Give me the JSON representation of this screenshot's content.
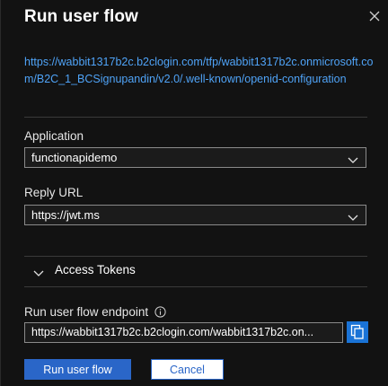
{
  "panel": {
    "title": "Run user flow",
    "metadata_url": "https://wabbit1317b2c.b2clogin.com/tfp/wabbit1317b2c.onmicrosoft.com/B2C_1_BCSignupandin/v2.0/.well-known/openid-configuration"
  },
  "application": {
    "label": "Application",
    "selected": "functionapidemo"
  },
  "reply_url": {
    "label": "Reply URL",
    "selected": "https://jwt.ms"
  },
  "access_tokens": {
    "label": "Access Tokens",
    "expanded": false
  },
  "endpoint": {
    "label": "Run user flow endpoint",
    "value": "https://wabbit1317b2c.b2clogin.com/wabbit1317b2c.on..."
  },
  "actions": {
    "run_label": "Run user flow",
    "cancel_label": "Cancel"
  },
  "icons": {
    "close": "close-icon",
    "chevron": "chevron-down-icon",
    "info": "info-icon",
    "copy": "copy-icon"
  },
  "colors": {
    "accent": "#2a66c8",
    "link": "#4fa3f7",
    "background": "#121212"
  }
}
